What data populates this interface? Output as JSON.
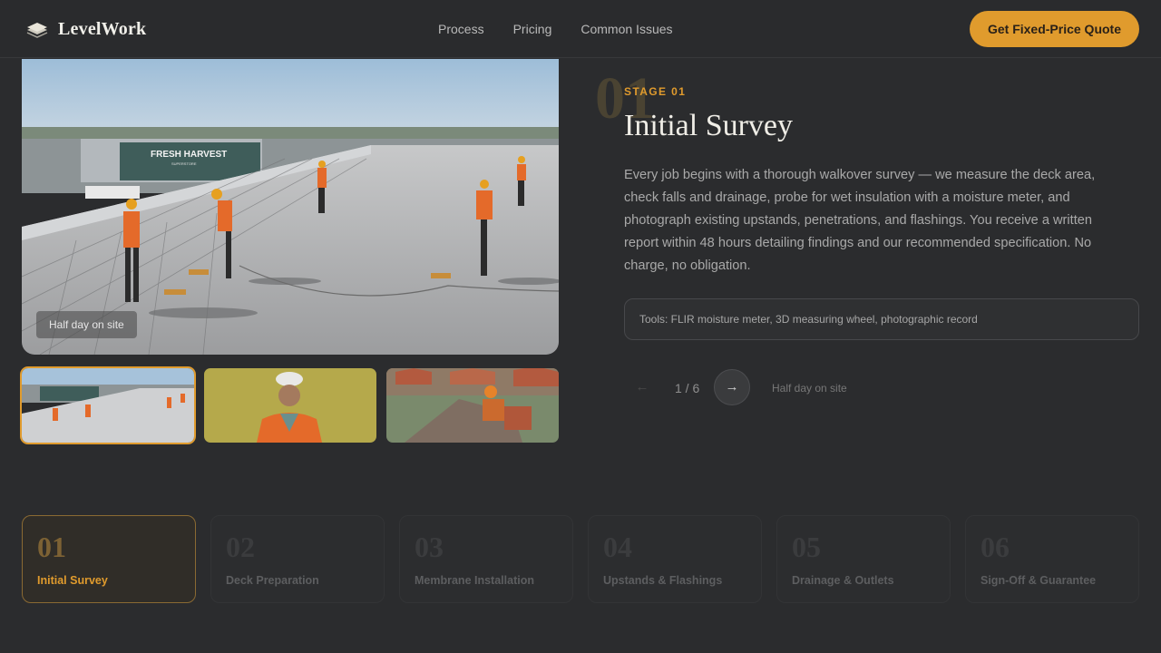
{
  "brand": {
    "name": "LevelWork",
    "icon": "stacked-layers-icon"
  },
  "nav": {
    "links": [
      "Process",
      "Pricing",
      "Common Issues"
    ],
    "cta_label": "Get Fixed-Price Quote"
  },
  "colors": {
    "accent": "#e09b2d",
    "background": "#2b2c2e"
  },
  "hero": {
    "photo_caption": "Half day on site",
    "storefront_sign": "FRESH HARVEST",
    "storefront_subsign": "SUPERSTORE"
  },
  "thumbnails": [
    {
      "subject": "roof-survey-crew",
      "active": true
    },
    {
      "subject": "worker-portrait",
      "active": false
    },
    {
      "subject": "roofer-at-work",
      "active": false
    }
  ],
  "stage": {
    "bg_number": "01",
    "eyebrow": "STAGE 01",
    "title": "Initial Survey",
    "description": "Every job begins with a thorough walkover survey — we measure the deck area, check falls and drainage, probe for wet insulation with a moisture meter, and photograph existing upstands, penetrations, and flashings. You receive a written report within 48 hours detailing findings and our recommended specification. No charge, no obligation.",
    "tools": "Tools: FLIR moisture meter, 3D measuring wheel, photographic record"
  },
  "pager": {
    "prev": "←",
    "count": "1 / 6",
    "next": "→",
    "duration": "Half day on site"
  },
  "stages": [
    {
      "num": "01",
      "label": "Initial Survey"
    },
    {
      "num": "02",
      "label": "Deck Preparation"
    },
    {
      "num": "03",
      "label": "Membrane Installation"
    },
    {
      "num": "04",
      "label": "Upstands & Flashings"
    },
    {
      "num": "05",
      "label": "Drainage & Outlets"
    },
    {
      "num": "06",
      "label": "Sign-Off & Guarantee"
    }
  ]
}
